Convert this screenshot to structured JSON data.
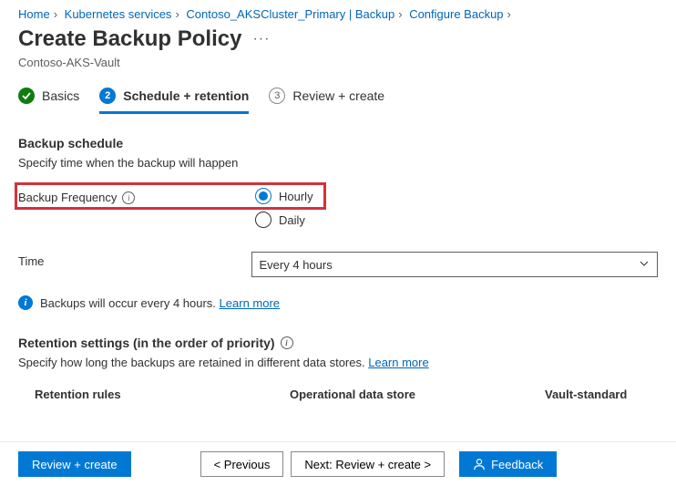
{
  "breadcrumb": [
    "Home",
    "Kubernetes services",
    "Contoso_AKSCluster_Primary | Backup",
    "Configure Backup"
  ],
  "header": {
    "title": "Create Backup Policy",
    "subtitle": "Contoso-AKS-Vault"
  },
  "tabs": [
    {
      "label": "Basics",
      "state": "done"
    },
    {
      "label": "Schedule + retention",
      "state": "current"
    },
    {
      "label": "Review + create",
      "state": "pending",
      "num": "3"
    }
  ],
  "schedule": {
    "section_title": "Backup schedule",
    "section_desc": "Specify time when the backup will happen",
    "freq_label": "Backup Frequency",
    "options": {
      "hourly": "Hourly",
      "daily": "Daily"
    },
    "selected": "hourly",
    "time_label": "Time",
    "time_value": "Every 4 hours",
    "info_text": "Backups will occur every 4 hours.",
    "learn_more": "Learn more"
  },
  "retention": {
    "section_title": "Retention settings (in the order of priority)",
    "section_desc": "Specify how long the backups are retained in different data stores.",
    "learn_more": "Learn more",
    "cols": [
      "Retention rules",
      "Operational data store",
      "Vault-standard"
    ]
  },
  "footer": {
    "review": "Review + create",
    "prev": "<  Previous",
    "next": "Next: Review + create  >",
    "feedback": "Feedback"
  }
}
